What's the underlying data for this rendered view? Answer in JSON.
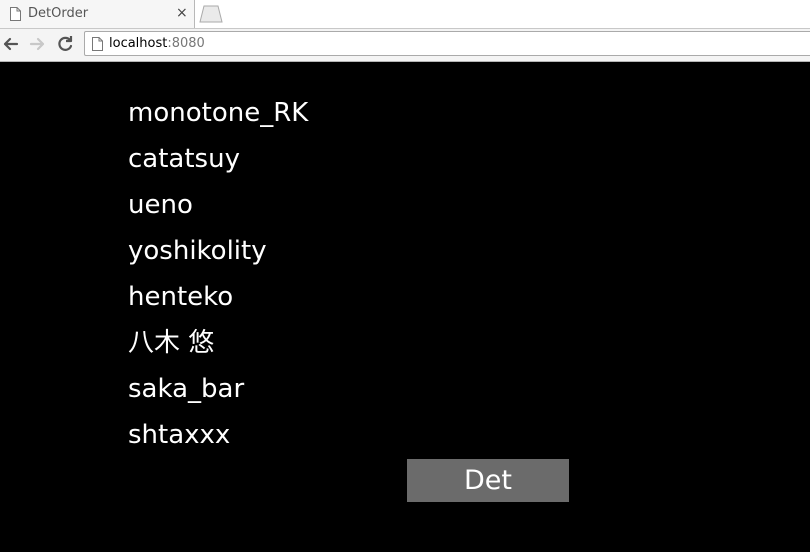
{
  "browser": {
    "tab_title": "DetOrder",
    "tab_close": "×",
    "url_host": "localhost",
    "url_port": ":8080"
  },
  "names": [
    "monotone_RK",
    "catatsuy",
    "ueno",
    "yoshikolity",
    "henteko",
    "八木 悠",
    "saka_bar",
    "shtaxxx"
  ],
  "button": {
    "label": "Det"
  }
}
